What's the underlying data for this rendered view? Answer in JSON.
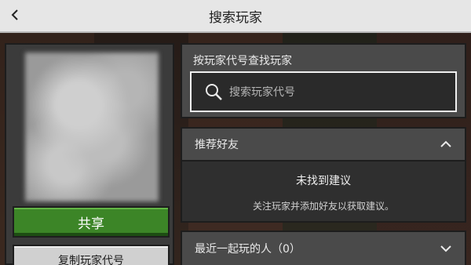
{
  "header": {
    "title": "搜索玩家"
  },
  "left": {
    "share_label": "共享",
    "copy_label": "复制玩家代号"
  },
  "search": {
    "label": "按玩家代号查找玩家",
    "placeholder": "搜索玩家代号"
  },
  "friends": {
    "title": "推荐好友",
    "empty_title": "未找到建议",
    "empty_hint": "关注玩家并添加好友以获取建议。"
  },
  "recent": {
    "title": "最近一起玩的人（0）"
  },
  "icons": {
    "back": "chevron-left-icon",
    "search": "magnifier-icon",
    "collapse": "chevron-up-icon",
    "expand": "chevron-down-icon"
  },
  "colors": {
    "share_button": "#3c8527",
    "copy_button": "#d0d0d0",
    "topbar": "#e6e6e6"
  }
}
